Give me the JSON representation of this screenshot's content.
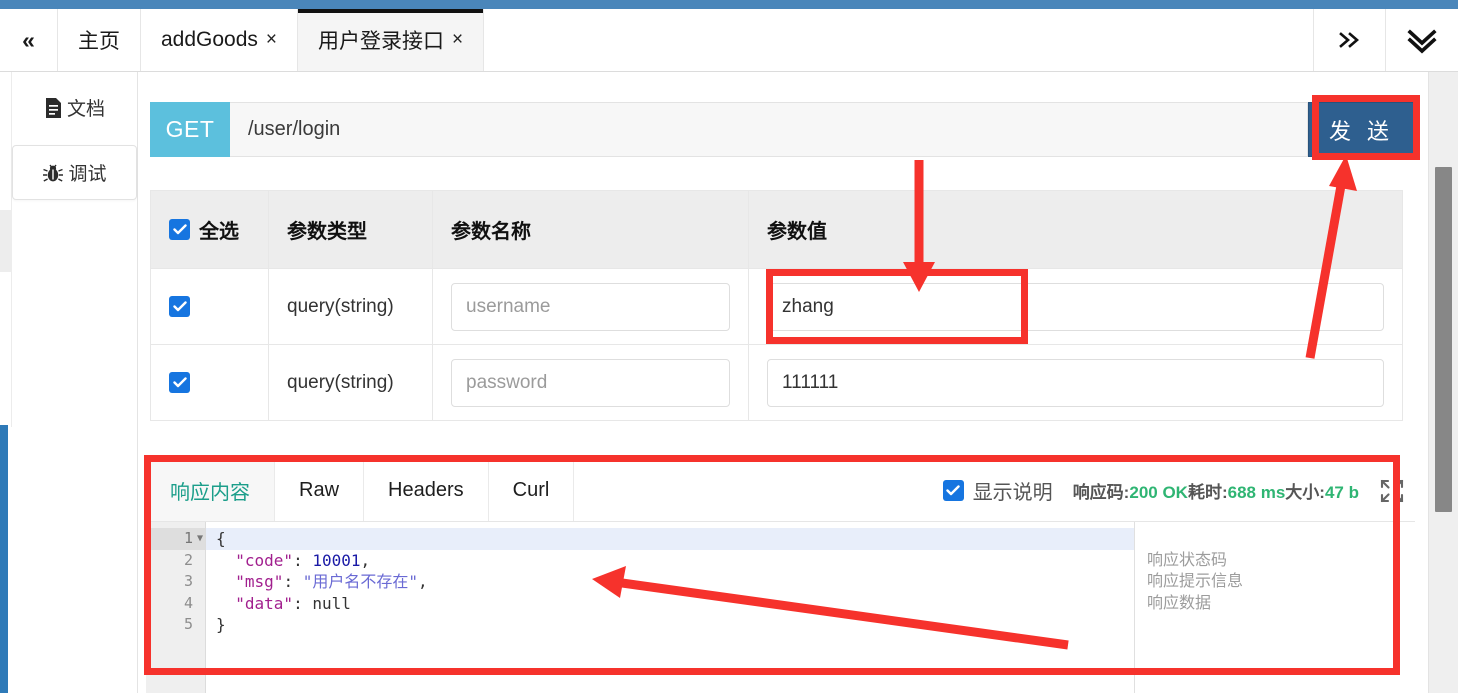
{
  "window": {
    "accent_blue": "#4a86ba",
    "annotation_color": "#f6322c"
  },
  "tabbar": {
    "collapse_icon": "chevron-double-left-icon",
    "collapse_label": "«",
    "tabs": [
      {
        "label": "主页",
        "closable": false,
        "active": false
      },
      {
        "label": "addGoods",
        "close": "×",
        "closable": true,
        "active": false
      },
      {
        "label": "用户登录接口",
        "close": "×",
        "closable": true,
        "active": true
      }
    ],
    "more_icon": "chevron-double-right-icon",
    "expand_icon": "chevron-double-down-icon"
  },
  "sidebar": {
    "items": [
      {
        "label": "文档",
        "icon": "document-icon",
        "active": false
      },
      {
        "label": "调试",
        "icon": "bug-icon",
        "active": true
      }
    ]
  },
  "request": {
    "method": "GET",
    "url": "/user/login",
    "send_label": "发 送"
  },
  "params_table": {
    "headers": {
      "select_all": "全选",
      "type": "参数类型",
      "name": "参数名称",
      "value": "参数值"
    },
    "select_all_checked": true,
    "rows": [
      {
        "checked": true,
        "type": "query(string)",
        "name_placeholder": "username",
        "name_value": "",
        "value_placeholder": "",
        "value": "zhang"
      },
      {
        "checked": true,
        "type": "query(string)",
        "name_placeholder": "password",
        "name_value": "",
        "value_placeholder": "",
        "value": "111111"
      }
    ]
  },
  "response": {
    "tabs": [
      {
        "label": "响应内容",
        "active": true
      },
      {
        "label": "Raw",
        "active": false
      },
      {
        "label": "Headers",
        "active": false
      },
      {
        "label": "Curl",
        "active": false
      }
    ],
    "show_desc_label": "显示说明",
    "show_desc_checked": true,
    "status": {
      "code_label": "响应码:",
      "code_value": "200 OK",
      "time_label": "耗时:",
      "time_value": "688 ms",
      "size_label": "大小:",
      "size_value": "47 b"
    },
    "expand_icon": "fullscreen-expand-icon",
    "line_numbers": [
      "1",
      "2",
      "3",
      "4",
      "5"
    ],
    "body_lines": [
      {
        "indent": 0,
        "segments": [
          {
            "t": "{",
            "c": "pun"
          }
        ]
      },
      {
        "indent": 1,
        "segments": [
          {
            "t": "\"code\"",
            "c": "key"
          },
          {
            "t": ": ",
            "c": "pun"
          },
          {
            "t": "10001",
            "c": "num"
          },
          {
            "t": ",",
            "c": "pun"
          }
        ]
      },
      {
        "indent": 1,
        "segments": [
          {
            "t": "\"msg\"",
            "c": "key"
          },
          {
            "t": ": ",
            "c": "pun"
          },
          {
            "t": "\"用户名不存在\"",
            "c": "str"
          },
          {
            "t": ",",
            "c": "pun"
          }
        ]
      },
      {
        "indent": 1,
        "segments": [
          {
            "t": "\"data\"",
            "c": "key"
          },
          {
            "t": ": ",
            "c": "pun"
          },
          {
            "t": "null",
            "c": "null"
          }
        ]
      },
      {
        "indent": 0,
        "segments": [
          {
            "t": "}",
            "c": "pun"
          }
        ]
      }
    ],
    "descriptions": [
      "",
      "响应状态码",
      "响应提示信息",
      "响应数据",
      ""
    ]
  },
  "annotations": {
    "boxes": [
      "send-button",
      "username-value-input",
      "response-panel"
    ],
    "arrows": [
      "arrow-to-username-value",
      "arrow-to-send-button",
      "arrow-to-response-body"
    ]
  }
}
